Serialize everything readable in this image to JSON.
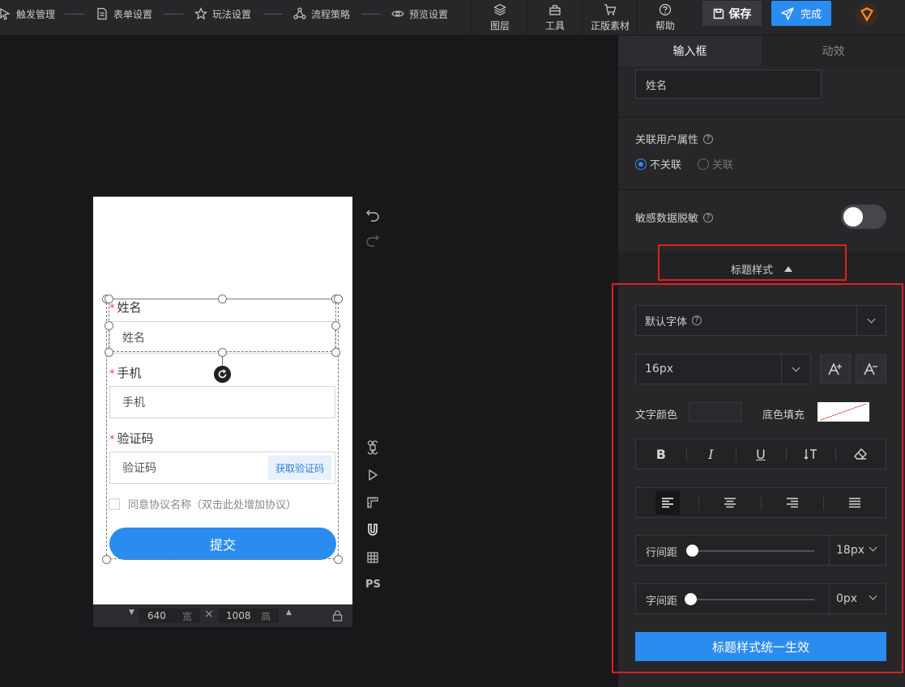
{
  "toolbar": {
    "steps": [
      "触发管理",
      "表单设置",
      "玩法设置",
      "流程策略",
      "预览设置"
    ],
    "tools": [
      "图层",
      "工具",
      "正版素材",
      "帮助"
    ],
    "save_label": "保存",
    "done_label": "完成"
  },
  "canvas": {
    "fields": [
      {
        "label": "姓名",
        "placeholder": "姓名"
      },
      {
        "label": "手机",
        "placeholder": "手机"
      },
      {
        "label": "验证码",
        "placeholder": "验证码",
        "action": "获取验证码"
      }
    ],
    "required_mark": "*",
    "agreement_text": "同意协议名称（双击此处增加协议）",
    "submit_label": "提交",
    "width_value": "640",
    "width_unit": "宽",
    "height_value": "1008",
    "height_unit": "高",
    "side_tool_ps": "PS"
  },
  "panel": {
    "tabs": [
      "输入框",
      "动效"
    ],
    "name_value": "姓名",
    "link_attr_label": "关联用户属性",
    "radio_options": [
      "不关联",
      "关联"
    ],
    "radio_selected": "不关联",
    "sensitive_label": "敏感数据脱敏",
    "sensitive_on": false,
    "title_style_label": "标题样式",
    "font_family": "默认字体",
    "font_size": "16px",
    "text_color_label": "文字颜色",
    "bg_fill_label": "底色填充",
    "text_color": "#2a2a2d",
    "line_height_label": "行间距",
    "line_height_value": "18px",
    "letter_spacing_label": "字间距",
    "letter_spacing_value": "0px",
    "apply_label": "标题样式统一生效"
  },
  "colors": {
    "accent": "#2b8cf0",
    "highlight": "#e02020"
  }
}
